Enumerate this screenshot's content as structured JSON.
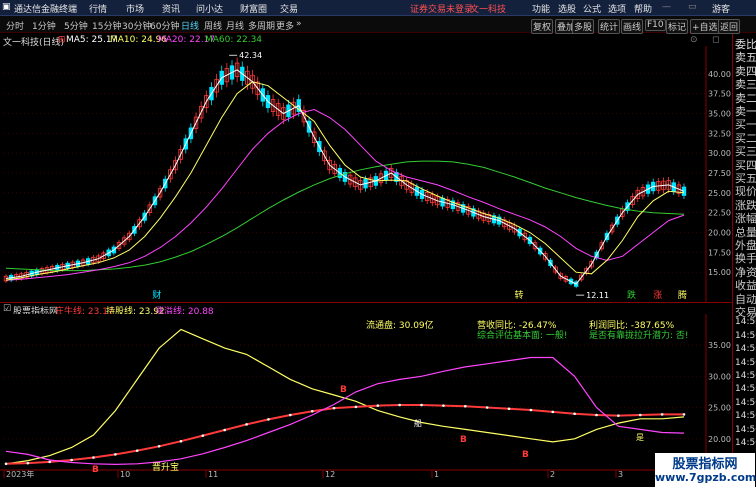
{
  "titlebar": {
    "app_name": "通达信金融终端",
    "menu": [
      "行情",
      "市场",
      "资讯",
      "问小达",
      "财富圈",
      "交易"
    ],
    "notice": "证券交易未登录",
    "stock": "文一科技",
    "right_menu": [
      "功能",
      "选股",
      "公式",
      "选项",
      "帮助",
      "游客"
    ]
  },
  "toolbar": {
    "periods": [
      "分时",
      "1分钟",
      "5分钟",
      "15分钟",
      "30分钟",
      "60分钟",
      "日线",
      "周线",
      "月线",
      "多周期",
      "更多"
    ],
    "active_period": "日线",
    "right_buttons": [
      "复权",
      "叠加",
      "多股",
      "统计",
      "画线",
      "F10",
      "标记",
      "+自选",
      "返回"
    ]
  },
  "chart_header": {
    "name": "文一科技(日线)",
    "ma5": "MA5: 25.17",
    "ma10": "MA10: 24.96",
    "ma20": "MA20: 22.17",
    "ma60": "MA60: 22.34"
  },
  "right_panel": {
    "items": [
      "委比",
      "卖五",
      "卖四",
      "卖三",
      "卖二",
      "卖一",
      "买一",
      "买二",
      "买三",
      "买四",
      "买五",
      "现价",
      "涨跌",
      "涨幅",
      "总量",
      "外盘",
      "换手",
      "净资",
      "收益",
      "自动",
      "交易",
      "14:50",
      "14:50",
      "14:50",
      "14:50",
      "14:50",
      "14:50",
      "14:50",
      "14:50",
      "14:50",
      "14:50"
    ]
  },
  "lower_header": {
    "indicator": "股票指标网",
    "line1": "庄牛线: 23.17",
    "line2": "持股线: 23.92",
    "line3": "涨溢线: 20.88",
    "float_cap": "流通盘: 30.09亿",
    "rev_yoy": "营收同比: -26.47%",
    "profit_yoy": "利润同比: -387.65%",
    "eval": "综合评估基本面: 一般!",
    "lift": "是否有靠拢拉升潜力: 否!"
  },
  "markers": {
    "cai": "财",
    "zhuan": "转",
    "die": "跌",
    "zhang": "涨",
    "teng": "腾",
    "high_label": "42.34",
    "low_label": "12.11",
    "jingtian": "晋升宝",
    "b": "B",
    "zhou": "船",
    "yes": "是"
  },
  "x_axis": {
    "labels": [
      "2023年",
      "10",
      "11",
      "12",
      "1",
      "2",
      "3"
    ]
  },
  "colors": {
    "up": "#ff3a3a",
    "down": "#00e5ff",
    "ma5": "#ffffff",
    "ma10": "#ffff66",
    "ma20": "#ff44ff",
    "ma60": "#33cc33"
  },
  "watermark": {
    "title": "股票指标网",
    "url": "www.7gpzb.com"
  },
  "chart_data": [
    {
      "type": "line",
      "title": "文一科技(日线)",
      "ylim": [
        12,
        43
      ],
      "y_ticks": [
        40.0,
        37.5,
        35.0,
        32.5,
        30.0,
        27.5,
        25.0,
        22.5,
        20.0,
        17.5,
        15.0
      ],
      "x_labels": [
        "2023年",
        "10",
        "11",
        "12",
        "1",
        "2",
        "3"
      ],
      "annotations": [
        {
          "label": "42.34"
        },
        {
          "label": "12.11"
        }
      ],
      "series": [
        {
          "name": "MA5",
          "values": [
            14.2,
            14.5,
            15.0,
            15.4,
            15.8,
            16.2,
            16.7,
            17.8,
            19.5,
            22.0,
            25.0,
            28.5,
            32.5,
            36.5,
            39.5,
            40.5,
            39.0,
            36.5,
            35.0,
            36.0,
            32.0,
            28.5,
            27.0,
            26.0,
            26.5,
            27.5,
            26.0,
            24.8,
            24.0,
            23.5,
            22.8,
            22.0,
            21.5,
            20.5,
            19.0,
            17.0,
            14.5,
            13.5,
            16.0,
            19.5,
            22.5,
            24.8,
            25.8,
            26.0,
            25.2
          ]
        },
        {
          "name": "MA10",
          "values": [
            14.0,
            14.3,
            14.7,
            15.0,
            15.4,
            15.8,
            16.2,
            16.8,
            17.8,
            19.5,
            21.8,
            24.5,
            27.5,
            31.0,
            34.5,
            37.5,
            39.0,
            38.5,
            37.0,
            35.5,
            34.0,
            31.0,
            28.5,
            27.0,
            26.5,
            26.6,
            26.5,
            25.5,
            24.6,
            23.8,
            23.1,
            22.4,
            21.8,
            21.0,
            20.0,
            18.6,
            16.8,
            15.0,
            14.8,
            16.5,
            19.0,
            22.0,
            24.0,
            25.2,
            25.0
          ]
        },
        {
          "name": "MA20",
          "values": [
            14.0,
            14.1,
            14.3,
            14.5,
            14.7,
            15.0,
            15.3,
            15.7,
            16.2,
            17.0,
            18.1,
            19.5,
            21.2,
            23.2,
            25.5,
            28.0,
            30.5,
            32.5,
            34.0,
            35.0,
            35.5,
            34.5,
            33.0,
            31.0,
            29.0,
            27.8,
            27.0,
            26.5,
            26.0,
            25.3,
            24.5,
            23.8,
            23.0,
            22.3,
            21.6,
            20.7,
            19.5,
            18.0,
            17.0,
            16.5,
            17.0,
            18.5,
            20.0,
            21.5,
            22.2
          ]
        },
        {
          "name": "MA60",
          "values": [
            15.5,
            15.4,
            15.3,
            15.2,
            15.2,
            15.2,
            15.3,
            15.4,
            15.6,
            15.9,
            16.3,
            16.9,
            17.6,
            18.5,
            19.5,
            20.6,
            21.8,
            23.0,
            24.1,
            25.1,
            26.0,
            26.8,
            27.4,
            27.9,
            28.3,
            28.6,
            28.9,
            29.0,
            29.0,
            28.9,
            28.6,
            28.2,
            27.6,
            27.0,
            26.3,
            25.6,
            25.0,
            24.4,
            23.9,
            23.4,
            23.0,
            22.7,
            22.5,
            22.4,
            22.3
          ]
        }
      ]
    },
    {
      "type": "line",
      "title": "股票指标网",
      "ylim": [
        15,
        39
      ],
      "y_ticks": [
        35.0,
        30.0,
        25.0,
        20.0
      ],
      "series": [
        {
          "name": "庄牛线",
          "values": [
            16.0,
            16.5,
            17.3,
            18.6,
            20.6,
            24.5,
            29.5,
            34.5,
            37.5,
            36.0,
            34.5,
            33.5,
            31.5,
            29.5,
            28.0,
            27.0,
            26.0,
            24.5,
            23.5,
            22.6,
            22.0,
            21.5,
            21.0,
            20.5,
            20.0,
            19.5,
            20.0,
            21.5,
            22.5,
            23.2,
            23.2,
            23.5
          ]
        },
        {
          "name": "持股线",
          "values": [
            16.0,
            16.1,
            16.3,
            16.6,
            17.0,
            17.5,
            18.1,
            18.8,
            19.6,
            20.5,
            21.4,
            22.3,
            23.1,
            23.8,
            24.4,
            24.9,
            25.1,
            25.3,
            25.4,
            25.4,
            25.3,
            25.2,
            25.0,
            24.8,
            24.6,
            24.3,
            24.0,
            23.8,
            23.7,
            23.8,
            23.9,
            23.9
          ]
        },
        {
          "name": "涨溢线",
          "values": [
            18.0,
            17.5,
            16.6,
            16.2,
            16.0,
            15.9,
            16.0,
            16.3,
            16.8,
            17.6,
            18.6,
            19.7,
            21.0,
            22.3,
            23.8,
            25.5,
            27.5,
            28.8,
            29.5,
            30.0,
            30.8,
            31.5,
            32.0,
            32.5,
            33.0,
            33.0,
            30.0,
            25.0,
            22.0,
            21.5,
            21.0,
            20.9
          ]
        }
      ]
    }
  ]
}
